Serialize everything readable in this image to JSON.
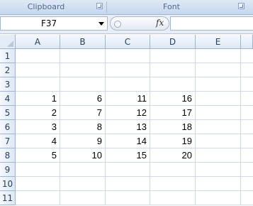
{
  "ribbon": {
    "groups": [
      {
        "label": "Clipboard"
      },
      {
        "label": "Font"
      }
    ]
  },
  "formula_bar": {
    "name_box": "F37",
    "fx_label": "fx",
    "formula": ""
  },
  "grid": {
    "columns": [
      "A",
      "B",
      "C",
      "D",
      "E"
    ],
    "rows": [
      {
        "num": "1",
        "cells": [
          "",
          "",
          "",
          "",
          ""
        ]
      },
      {
        "num": "2",
        "cells": [
          "",
          "",
          "",
          "",
          ""
        ]
      },
      {
        "num": "3",
        "cells": [
          "",
          "",
          "",
          "",
          ""
        ]
      },
      {
        "num": "4",
        "cells": [
          "1",
          "6",
          "11",
          "16",
          ""
        ]
      },
      {
        "num": "5",
        "cells": [
          "2",
          "7",
          "12",
          "17",
          ""
        ]
      },
      {
        "num": "6",
        "cells": [
          "3",
          "8",
          "13",
          "18",
          ""
        ]
      },
      {
        "num": "7",
        "cells": [
          "4",
          "9",
          "14",
          "19",
          ""
        ]
      },
      {
        "num": "8",
        "cells": [
          "5",
          "10",
          "15",
          "20",
          ""
        ]
      },
      {
        "num": "9",
        "cells": [
          "",
          "",
          "",
          "",
          ""
        ]
      },
      {
        "num": "10",
        "cells": [
          "",
          "",
          "",
          "",
          ""
        ]
      },
      {
        "num": "11",
        "cells": [
          "",
          "",
          "",
          "",
          ""
        ]
      }
    ]
  }
}
